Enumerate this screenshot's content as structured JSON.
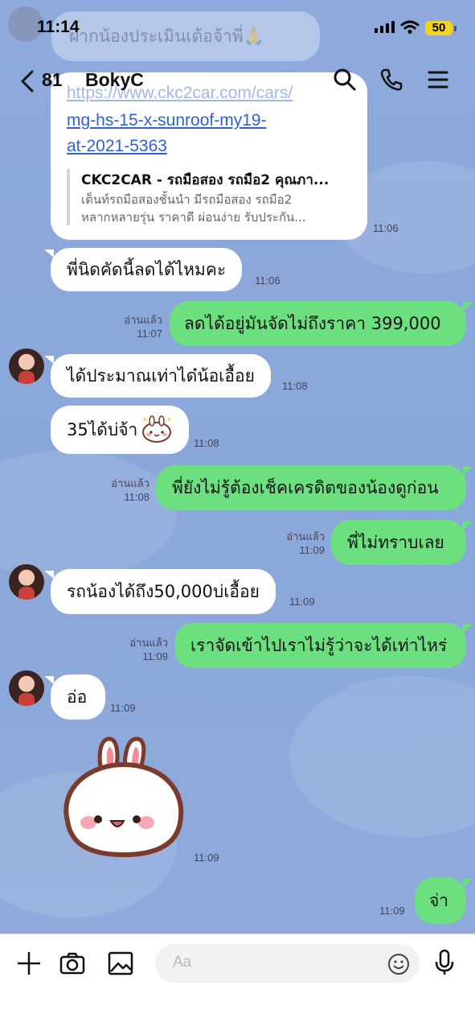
{
  "status_bar": {
    "time": "11:14",
    "battery": "50"
  },
  "header": {
    "back_count": "81",
    "chat_name": "BokyC"
  },
  "ghost_message": {
    "text": "ฝากน้องประเมินเต้อจ้าพี่🙏"
  },
  "link_message": {
    "url_lines": [
      "https://www.ckc2car.com/cars/",
      "mg-hs-15-x-sunroof-my19-",
      "at-2021-5363"
    ],
    "preview_title": "CKC2CAR - รถมือสอง รถมือ2 คุณภา...",
    "preview_desc_lines": [
      "เต็นท์รถมือสองชั้นนำ มีรถมือสอง รถมือ2",
      "หลากหลายรุ่น ราคาดี ผ่อนง่าย รับประกัน..."
    ],
    "time": "11:06"
  },
  "messages": [
    {
      "id": "m1",
      "dir": "in",
      "text": "พี่นิดคัดนี้ลดได้ไหมคะ",
      "time": "11:06"
    },
    {
      "id": "m2",
      "dir": "out",
      "text": "ลดได้อยู่มันจัดไม่ถึงราคา 399,000",
      "read": "อ่านแล้ว",
      "time": "11:07"
    },
    {
      "id": "m3",
      "dir": "in",
      "text": "ได้ประมาณเท่าได๋น้อเอื้อย",
      "time": "11:08"
    },
    {
      "id": "m4",
      "dir": "in",
      "text": "35ได้บ่จ้า",
      "time": "11:08"
    },
    {
      "id": "m5",
      "dir": "out",
      "text": "พี่ยังไม่รู้ต้องเช็คเครดิตของน้องดูก่อน",
      "read": "อ่านแล้ว",
      "time": "11:08"
    },
    {
      "id": "m6",
      "dir": "out",
      "text": "พี่ไม่ทราบเลย",
      "read": "อ่านแล้ว",
      "time": "11:09"
    },
    {
      "id": "m7",
      "dir": "in",
      "text": "รถน้องได้ถึง50,000บ่เอื้อย",
      "time": "11:09"
    },
    {
      "id": "m8",
      "dir": "out",
      "text": "เราจัดเข้าไปเราไม่รู้ว่าจะได้เท่าไหร่",
      "read": "อ่านแล้ว",
      "time": "11:09"
    },
    {
      "id": "m9",
      "dir": "in",
      "text": "อ่อ",
      "time": "11:09"
    },
    {
      "id": "m10",
      "dir": "in",
      "text": "",
      "time": "11:09",
      "sticker": "bunny-sticker"
    },
    {
      "id": "m11",
      "dir": "out",
      "text": "จ่า",
      "time": "11:09"
    }
  ],
  "input_bar": {
    "placeholder": "Aa"
  },
  "colors": {
    "chat_bg": "#8eaadc",
    "outgoing": "#6ce07f",
    "incoming": "#ffffff",
    "link": "#2f62d6"
  }
}
